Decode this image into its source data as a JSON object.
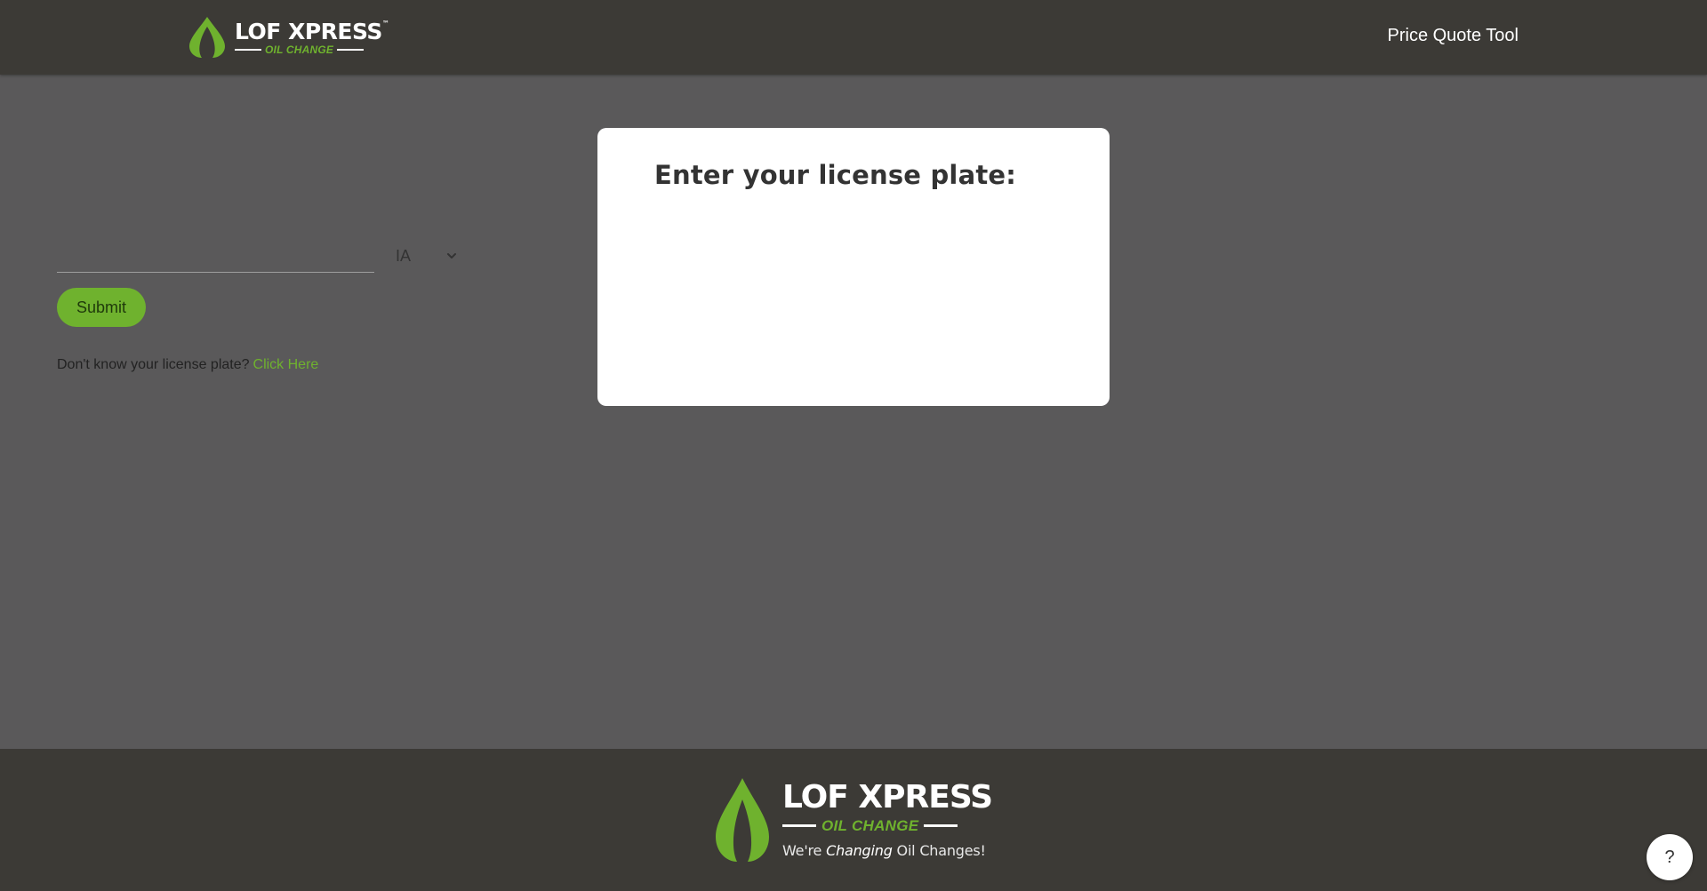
{
  "header": {
    "logo_brand": "LOF XPRESS",
    "logo_subtitle": "OIL CHANGE",
    "logo_trademark": "™",
    "nav_title": "Price Quote Tool"
  },
  "form": {
    "title": "Enter your license plate:",
    "plate_value": "",
    "plate_placeholder": "",
    "state_selected": "IA",
    "submit_label": "Submit",
    "help_text": "Don't know your license plate?",
    "help_link": "Click Here"
  },
  "footer": {
    "logo_brand": "LOF XPRESS",
    "logo_subtitle": "OIL CHANGE",
    "tagline_prefix": "We're",
    "tagline_em": "Changing",
    "tagline_suffix": "Oil Changes!"
  },
  "help_fab": {
    "label": "?"
  },
  "colors": {
    "header_bg": "#3c3a36",
    "page_bg": "#5a595a",
    "accent_green": "#6fb22e",
    "card_bg": "#ffffff"
  },
  "icons": {
    "logo": "oil-drop-logo-icon",
    "dropdown": "chevron-down-icon",
    "help": "help-question-icon"
  }
}
